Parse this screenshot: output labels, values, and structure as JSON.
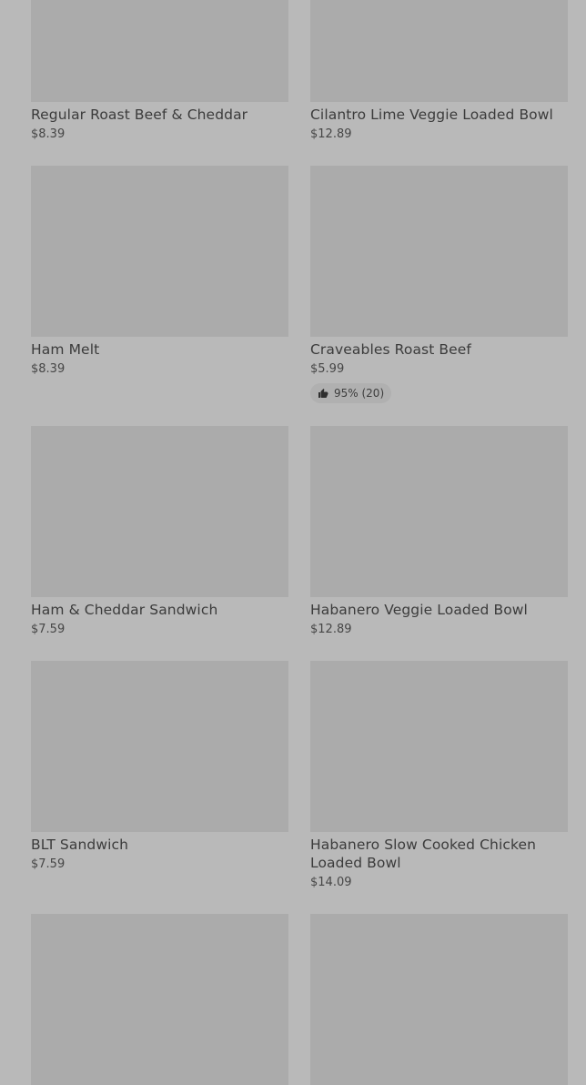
{
  "products": [
    {
      "name": "Regular Roast Beef & Cheddar",
      "price": "$8.39"
    },
    {
      "name": "Cilantro Lime Veggie Loaded Bowl",
      "price": "$12.89"
    },
    {
      "name": "Ham Melt",
      "price": "$8.39"
    },
    {
      "name": "Craveables Roast Beef",
      "price": "$5.99",
      "rating": "95% (20)"
    },
    {
      "name": "Ham & Cheddar Sandwich",
      "price": "$7.59"
    },
    {
      "name": "Habanero Veggie Loaded Bowl",
      "price": "$12.89"
    },
    {
      "name": "BLT Sandwich",
      "price": "$7.59"
    },
    {
      "name": "Habanero Slow Cooked Chicken Loaded Bowl",
      "price": "$14.09"
    },
    {
      "name": "",
      "price": ""
    },
    {
      "name": "",
      "price": ""
    }
  ],
  "icons": {
    "rating": "thumbs-up-icon"
  }
}
